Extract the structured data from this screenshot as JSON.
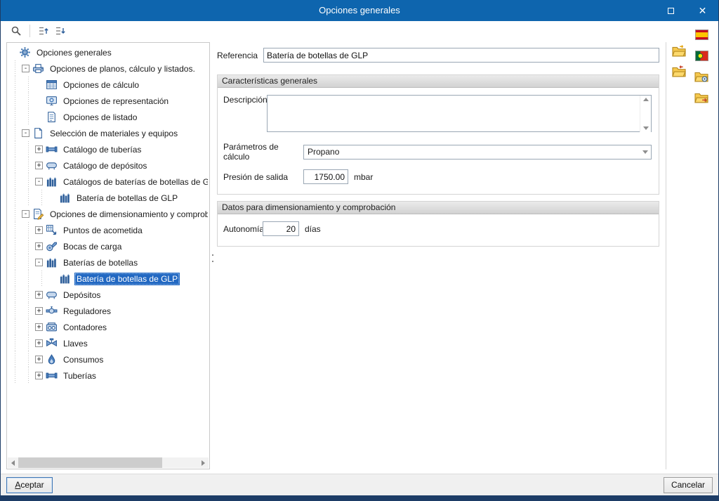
{
  "window": {
    "title": "Opciones generales"
  },
  "toolbar": {
    "items": [
      {
        "name": "search-icon",
        "icon": "search"
      },
      {
        "name": "separator"
      },
      {
        "name": "collapse-tree-levels-icon",
        "icon": "treeup"
      },
      {
        "name": "expand-tree-levels-icon",
        "icon": "treedown"
      }
    ]
  },
  "tree": {
    "items": [
      {
        "label": "Opciones generales",
        "depth": 0,
        "expander": "none",
        "icon": "gear",
        "selected": false
      },
      {
        "label": "Opciones de planos, cálculo y listados.",
        "depth": 1,
        "expander": "minus",
        "icon": "plans",
        "selected": false
      },
      {
        "label": "Opciones de cálculo",
        "depth": 2,
        "expander": "none",
        "icon": "calc",
        "selected": false
      },
      {
        "label": "Opciones de representación",
        "depth": 2,
        "expander": "none",
        "icon": "repr",
        "selected": false
      },
      {
        "label": "Opciones de listado",
        "depth": 2,
        "expander": "none",
        "icon": "listing",
        "selected": false
      },
      {
        "label": "Selección de materiales y equipos",
        "depth": 1,
        "expander": "minus",
        "icon": "page",
        "selected": false
      },
      {
        "label": "Catálogo de tuberías",
        "depth": 2,
        "expander": "plus",
        "icon": "pipe",
        "selected": false
      },
      {
        "label": "Catálogo de depósitos",
        "depth": 2,
        "expander": "plus",
        "icon": "tank",
        "selected": false
      },
      {
        "label": "Catálogos de baterías de botellas de GLP",
        "depth": 2,
        "expander": "minus",
        "icon": "bottles",
        "selected": false
      },
      {
        "label": "Batería de botellas de GLP",
        "depth": 3,
        "expander": "none",
        "icon": "bottles",
        "selected": false
      },
      {
        "label": "Opciones de dimensionamiento y comprobación",
        "depth": 1,
        "expander": "minus",
        "icon": "dim",
        "selected": false
      },
      {
        "label": "Puntos de acometida",
        "depth": 2,
        "expander": "plus",
        "icon": "acometida",
        "selected": false
      },
      {
        "label": "Bocas de carga",
        "depth": 2,
        "expander": "plus",
        "icon": "boca",
        "selected": false
      },
      {
        "label": "Baterías de botellas",
        "depth": 2,
        "expander": "minus",
        "icon": "bottles",
        "selected": false
      },
      {
        "label": "Batería de botellas de GLP",
        "depth": 3,
        "expander": "none",
        "icon": "bottles",
        "selected": true
      },
      {
        "label": "Depósitos",
        "depth": 2,
        "expander": "plus",
        "icon": "tank",
        "selected": false
      },
      {
        "label": "Reguladores",
        "depth": 2,
        "expander": "plus",
        "icon": "regulator",
        "selected": false
      },
      {
        "label": "Contadores",
        "depth": 2,
        "expander": "plus",
        "icon": "meter",
        "selected": false
      },
      {
        "label": "Llaves",
        "depth": 2,
        "expander": "plus",
        "icon": "valve",
        "selected": false
      },
      {
        "label": "Consumos",
        "depth": 2,
        "expander": "plus",
        "icon": "flame",
        "selected": false
      },
      {
        "label": "Tuberías",
        "depth": 2,
        "expander": "plus",
        "icon": "pipe",
        "selected": false
      }
    ]
  },
  "form": {
    "referencia": {
      "label": "Referencia",
      "value": "Batería de botellas de GLP"
    },
    "caracteristicas": {
      "title": "Características generales",
      "descripcion_label": "Descripción",
      "descripcion_value": "",
      "parametros_label": "Parámetros de cálculo",
      "parametros_value": "Propano",
      "presion_label": "Presión de salida",
      "presion_value": "1750.00",
      "presion_unit": "mbar"
    },
    "datos": {
      "title": "Datos para dimensionamiento y comprobación",
      "autonomia_label": "Autonomía",
      "autonomia_value": "20",
      "autonomia_unit": "días"
    }
  },
  "right_toolbar": {
    "col1": [
      {
        "name": "load-options-folder-icon",
        "icon": "folder_load"
      },
      {
        "name": "save-options-folder-icon",
        "icon": "folder_save"
      }
    ],
    "col2": [
      {
        "name": "spanish-flag-icon",
        "icon": "flag_es"
      },
      {
        "name": "portuguese-flag-icon",
        "icon": "flag_pt"
      },
      {
        "name": "options-gear-folder-icon",
        "icon": "folder_gear"
      },
      {
        "name": "export-options-folder-icon",
        "icon": "folder_export"
      }
    ]
  },
  "footer": {
    "accept": "Aceptar",
    "cancel": "Cancelar"
  },
  "colors": {
    "titlebar": "#0e65ae",
    "selection": "#2268c2",
    "bottom_strip": "#1d3c66",
    "group_header": "#d9d9d9"
  }
}
